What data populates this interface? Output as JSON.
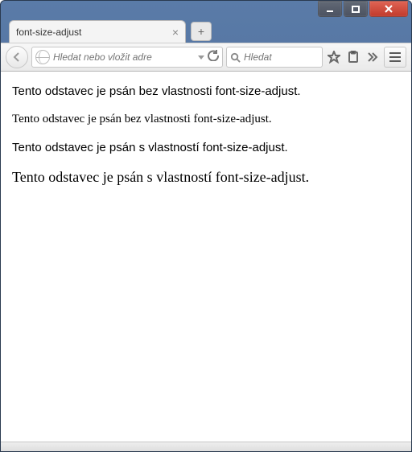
{
  "window": {
    "tab_title": "font-size-adjust"
  },
  "toolbar": {
    "url_placeholder": "Hledat nebo vložit adre",
    "search_placeholder": "Hledat"
  },
  "content": {
    "p1": "Tento odstavec je psán bez vlastnosti font-size-adjust.",
    "p2": "Tento odstavec je psán bez vlastnosti font-size-adjust.",
    "p3": "Tento odstavec je psán s vlastností font-size-adjust.",
    "p4": "Tento odstavec je psán s vlastností font-size-adjust."
  }
}
